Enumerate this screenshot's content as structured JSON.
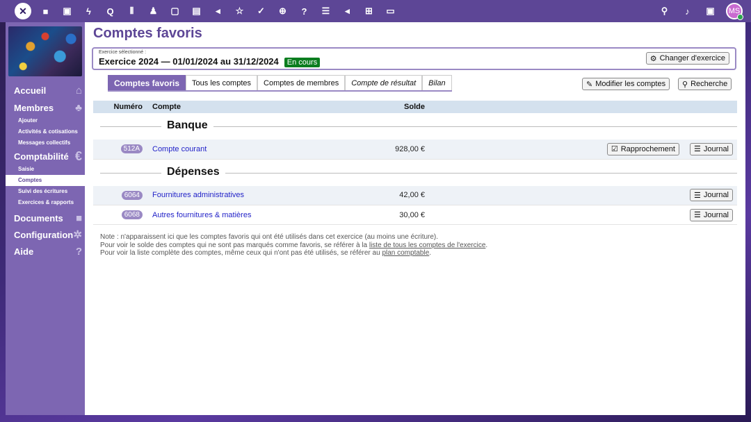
{
  "topbar": {
    "logo_icon": "paheko-logo",
    "icons": [
      "folder-icon",
      "image-icon",
      "bolt-icon",
      "search-q-icon",
      "columns-icon",
      "users-icon",
      "calendar-icon",
      "drawer-icon",
      "megaphone-icon",
      "star-icon",
      "check-icon",
      "globe-icon",
      "help-icon",
      "list-icon",
      "plugin-icon",
      "grid-icon",
      "monitor-icon"
    ],
    "right_icons": [
      "search-icon",
      "bell-icon",
      "address-book-icon"
    ],
    "avatar_initials": "MS"
  },
  "sidebar": {
    "items": [
      {
        "label": "Accueil",
        "icon": "home-icon",
        "subitems": []
      },
      {
        "label": "Membres",
        "icon": "people-icon",
        "subitems": [
          "Ajouter",
          "Activités & cotisations",
          "Messages collectifs"
        ]
      },
      {
        "label": "Comptabilité",
        "icon": "euro-icon",
        "subitems": [
          "Saisie",
          "Comptes",
          "Suivi des écritures",
          "Exercices & rapports"
        ]
      },
      {
        "label": "Documents",
        "icon": "folder-icon",
        "subitems": []
      },
      {
        "label": "Configuration",
        "icon": "cog-icon",
        "subitems": []
      },
      {
        "label": "Aide",
        "icon": "question-icon",
        "subitems": []
      }
    ],
    "active_subitem": "Comptes"
  },
  "page": {
    "title": "Comptes favoris",
    "exercise_caption": "Exercice sélectionné :",
    "exercise_title": "Exercice 2024 — 01/01/2024 au 31/12/2024",
    "exercise_status": "En cours",
    "change_button": "Changer d'exercice",
    "tabs": [
      "Comptes favoris",
      "Tous les comptes",
      "Comptes de membres",
      "Compte de résultat",
      "Bilan"
    ],
    "modify_button": "Modifier les comptes",
    "search_button": "Recherche"
  },
  "table": {
    "headers": {
      "num": "Numéro",
      "account": "Compte",
      "balance": "Solde"
    },
    "sections": [
      {
        "title": "Banque",
        "rows": [
          {
            "num": "512A",
            "account": "Compte courant",
            "balance": "928,00 €",
            "reconcile": "Rapprochement",
            "journal": "Journal"
          }
        ]
      },
      {
        "title": "Dépenses",
        "rows": [
          {
            "num": "6064",
            "account": "Fournitures administratives",
            "balance": "42,00 €",
            "journal": "Journal"
          },
          {
            "num": "6068",
            "account": "Autres fournitures & matières",
            "balance": "30,00 €",
            "journal": "Journal"
          }
        ]
      }
    ]
  },
  "note": {
    "line1": "Note : n'apparaissent ici que les comptes favoris qui ont été utilisés dans cet exercice (au moins une écriture).",
    "line2_pre": "Pour voir le solde des comptes qui ne sont pas marqués comme favoris, se référer à la ",
    "line2_link": "liste de tous les comptes de l'exercice",
    "line2_post": ".",
    "line3_pre": "Pour voir la liste complète des comptes, même ceux qui n'ont pas été utilisés, se référer au ",
    "line3_link": "plan comptable",
    "line3_post": "."
  }
}
